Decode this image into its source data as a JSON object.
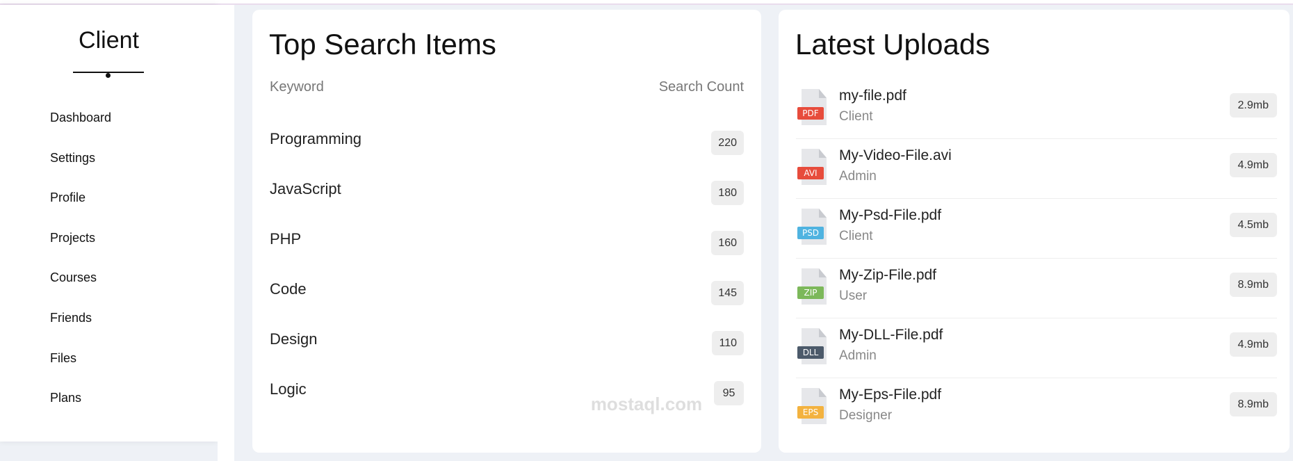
{
  "sidebar": {
    "brand": "Client",
    "items": [
      {
        "label": "Dashboard"
      },
      {
        "label": "Settings"
      },
      {
        "label": "Profile"
      },
      {
        "label": "Projects"
      },
      {
        "label": "Courses"
      },
      {
        "label": "Friends"
      },
      {
        "label": "Files"
      },
      {
        "label": "Plans"
      }
    ]
  },
  "search_panel": {
    "title": "Top Search Items",
    "col_keyword": "Keyword",
    "col_count": "Search Count",
    "rows": [
      {
        "keyword": "Programming",
        "count": "220"
      },
      {
        "keyword": "JavaScript",
        "count": "180"
      },
      {
        "keyword": "PHP",
        "count": "160"
      },
      {
        "keyword": "Code",
        "count": "145"
      },
      {
        "keyword": "Design",
        "count": "110"
      },
      {
        "keyword": "Logic",
        "count": "95"
      }
    ]
  },
  "uploads_panel": {
    "title": "Latest Uploads",
    "files": [
      {
        "name": "my-file.pdf",
        "user": "Client",
        "size": "2.9mb",
        "tag": "PDF",
        "tag_color": "#e74c3c",
        "icon": "pdf-file-icon"
      },
      {
        "name": "My-Video-File.avi",
        "user": "Admin",
        "size": "4.9mb",
        "tag": "AVI",
        "tag_color": "#e74c3c",
        "icon": "avi-file-icon"
      },
      {
        "name": "My-Psd-File.pdf",
        "user": "Client",
        "size": "4.5mb",
        "tag": "PSD",
        "tag_color": "#4fb3e0",
        "icon": "psd-file-icon"
      },
      {
        "name": "My-Zip-File.pdf",
        "user": "User",
        "size": "8.9mb",
        "tag": "ZIP",
        "tag_color": "#7cb85a",
        "icon": "zip-file-icon"
      },
      {
        "name": "My-DLL-File.pdf",
        "user": "Admin",
        "size": "4.9mb",
        "tag": "DLL",
        "tag_color": "#4c5a6a",
        "icon": "dll-file-icon"
      },
      {
        "name": "My-Eps-File.pdf",
        "user": "Designer",
        "size": "8.9mb",
        "tag": "EPS",
        "tag_color": "#f3b23f",
        "icon": "eps-file-icon"
      }
    ]
  },
  "watermark": {
    "text": "mostaql.com"
  }
}
